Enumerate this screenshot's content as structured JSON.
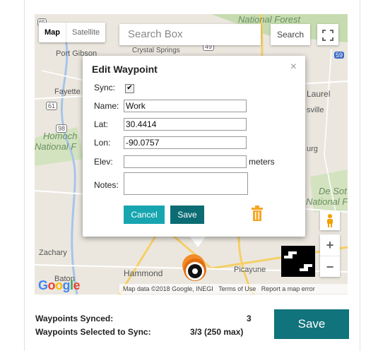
{
  "map": {
    "type_buttons": [
      "Map",
      "Satellite"
    ],
    "search_placeholder": "Search Box",
    "search_button": "Search",
    "places": {
      "national_forest": "National Forest",
      "port_gibson": "Port Gibson",
      "crystal_springs": "Crystal Springs",
      "fayette": "Fayette",
      "homochitto": "Homoch",
      "national_f": "National F",
      "laurel": "Laurel",
      "sville": "sville",
      "burg": "urg",
      "de_soto": "De Sot",
      "national_fo": "National Fo",
      "zachary": "Zachary",
      "hammond": "Hammond",
      "picayune": "Picayune",
      "baton": "Baton"
    },
    "route_shields": [
      "61",
      "98",
      "49",
      "59",
      "65"
    ],
    "google_letters": [
      "G",
      "o",
      "o",
      "g",
      "l",
      "e"
    ],
    "attribution": {
      "data": "Map data ©2018 Google, INEGI",
      "terms": "Terms of Use",
      "report": "Report a map error"
    },
    "colors": {
      "water": "#a6c5e8",
      "forest": "#c6dcb0",
      "road": "#ffffff",
      "highway": "#f6cf65"
    }
  },
  "dialog": {
    "title": "Edit Waypoint",
    "close": "×",
    "sync_label": "Sync:",
    "sync_checked": "✔",
    "name_label": "Name:",
    "name_value": "Work",
    "lat_label": "Lat:",
    "lat_value": "30.4414",
    "lon_label": "Lon:",
    "lon_value": "-90.0757",
    "elev_label": "Elev:",
    "elev_value": "",
    "elev_unit": "meters",
    "notes_label": "Notes:",
    "notes_value": "",
    "cancel": "Cancel",
    "save": "Save",
    "colors": {
      "cancel": "#17a5b0",
      "save": "#0b6c73",
      "trash": "#f5a623"
    }
  },
  "summary": {
    "synced_label": "Waypoints Synced:",
    "synced_value": "3",
    "selected_label": "Waypoints Selected to Sync:",
    "selected_value": "3/3 (250 max)",
    "save": "Save"
  }
}
